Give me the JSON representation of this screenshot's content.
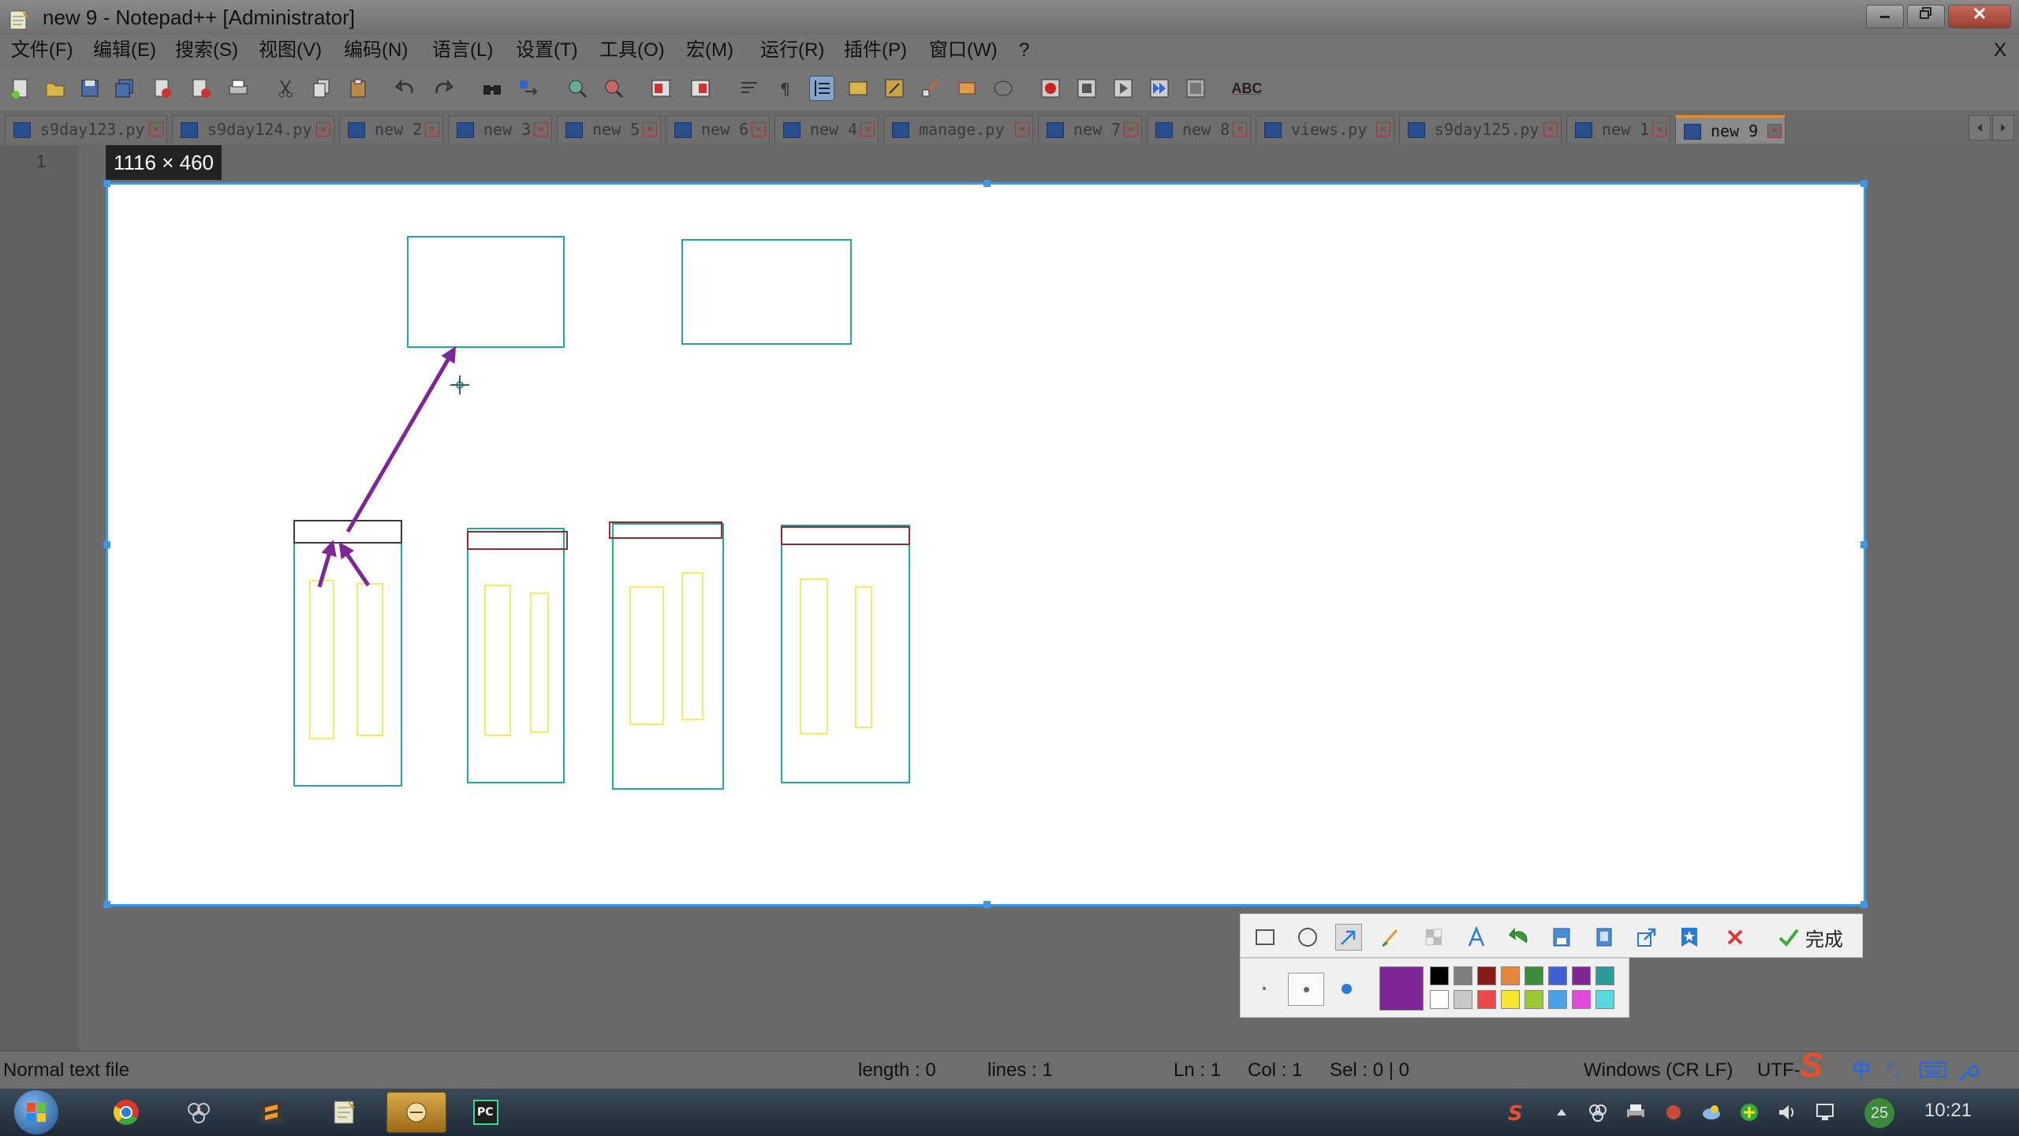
{
  "window": {
    "title": "new 9 - Notepad++ [Administrator]",
    "controls": [
      "minimize",
      "restore",
      "close"
    ]
  },
  "menu": {
    "items": [
      "文件(F)",
      "编辑(E)",
      "搜索(S)",
      "视图(V)",
      "编码(N)",
      "语言(L)",
      "设置(T)",
      "工具(O)",
      "宏(M)",
      "运行(R)",
      "插件(P)",
      "窗口(W)",
      "?"
    ],
    "close_glyph": "X"
  },
  "toolbar": {
    "icons": [
      "new-file-icon",
      "open-file-icon",
      "save-icon",
      "save-all-icon",
      "close-icon",
      "close-all-icon",
      "print-icon",
      "cut-icon",
      "copy-icon",
      "paste-icon",
      "undo-icon",
      "redo-icon",
      "find-icon",
      "replace-icon",
      "zoom-in-icon",
      "zoom-out-icon",
      "sync-v-icon",
      "sync-h-icon",
      "word-wrap-icon",
      "show-all-chars-icon",
      "indent-guide-icon",
      "doc-map-icon",
      "function-list-icon",
      "folder-workspace-icon",
      "doc-list-icon",
      "monitor-icon",
      "record-macro-icon",
      "stop-record-icon",
      "play-macro-icon",
      "run-macro-multiple-icon",
      "save-macro-icon",
      "spell-check-icon"
    ],
    "spell_label": "ABC"
  },
  "tabs": [
    {
      "label": "s9day123.py",
      "active": false
    },
    {
      "label": "s9day124.py",
      "active": false
    },
    {
      "label": "new 2",
      "active": false
    },
    {
      "label": "new 3",
      "active": false
    },
    {
      "label": "new 5",
      "active": false
    },
    {
      "label": "new 6",
      "active": false
    },
    {
      "label": "new 4",
      "active": false
    },
    {
      "label": "manage.py",
      "active": false
    },
    {
      "label": "new 7",
      "active": false
    },
    {
      "label": "new 8",
      "active": false
    },
    {
      "label": "views.py",
      "active": false
    },
    {
      "label": "s9day125.py",
      "active": false
    },
    {
      "label": "new 1",
      "active": false
    },
    {
      "label": "new 9",
      "active": true
    }
  ],
  "tab_close_glyph": "×",
  "editor": {
    "line_number": "1"
  },
  "capture": {
    "size_label": "1116 × 460",
    "drawing": {
      "colors": {
        "box_stroke": "#2aa3a8",
        "inner_bar_stroke": "#f2ea6a",
        "header_stroke": "#3a3a3a",
        "header_stroke_red": "#8b2d2d",
        "arrow": "#7e2598"
      }
    }
  },
  "annotation_toolbar": {
    "tools": [
      "rectangle-icon",
      "ellipse-icon",
      "arrow-icon",
      "brush-icon",
      "mosaic-icon",
      "text-icon",
      "undo-icon",
      "save-icon",
      "pin-icon",
      "share-icon",
      "favorite-icon",
      "cancel-icon"
    ],
    "active_tool": "arrow-icon",
    "done_label": "完成",
    "pen_sizes": [
      "small",
      "medium",
      "large"
    ],
    "selected_size": "medium",
    "current_color": "#7e2598",
    "palette_top": [
      "#000000",
      "#7f7f7f",
      "#8b1a1a",
      "#e8873a",
      "#3c8c3c",
      "#3f5fd8",
      "#7e2598",
      "#2a9a9a"
    ],
    "palette_bottom": [
      "#ffffff",
      "#c8c8c8",
      "#e84a4a",
      "#f5e62a",
      "#9ac83a",
      "#4aa0e8",
      "#e04ad8",
      "#5ad8e0"
    ]
  },
  "status": {
    "file_type": "Normal text file",
    "length": "length : 0",
    "lines": "lines : 1",
    "ln": "Ln : 1",
    "col": "Col : 1",
    "sel": "Sel : 0 | 0",
    "eol": "Windows (CR LF)",
    "encoding": "UTF-"
  },
  "ime": {
    "lang": "中",
    "punct": "°,",
    "logo": "S"
  },
  "taskbar": {
    "apps": [
      "start-orb-icon",
      "chrome-icon",
      "app-icon",
      "sublime-icon",
      "notepad-icon",
      "screenshot-app-icon",
      "pycharm-icon"
    ],
    "tray_icons": [
      "sogou-icon",
      "tray-arrow-icon",
      "network-app-icon",
      "printer-icon",
      "bug-icon",
      "cloud-icon",
      "green-plus-icon",
      "volume-icon",
      "network-icon"
    ],
    "badge": "25",
    "clock": "10:21"
  }
}
